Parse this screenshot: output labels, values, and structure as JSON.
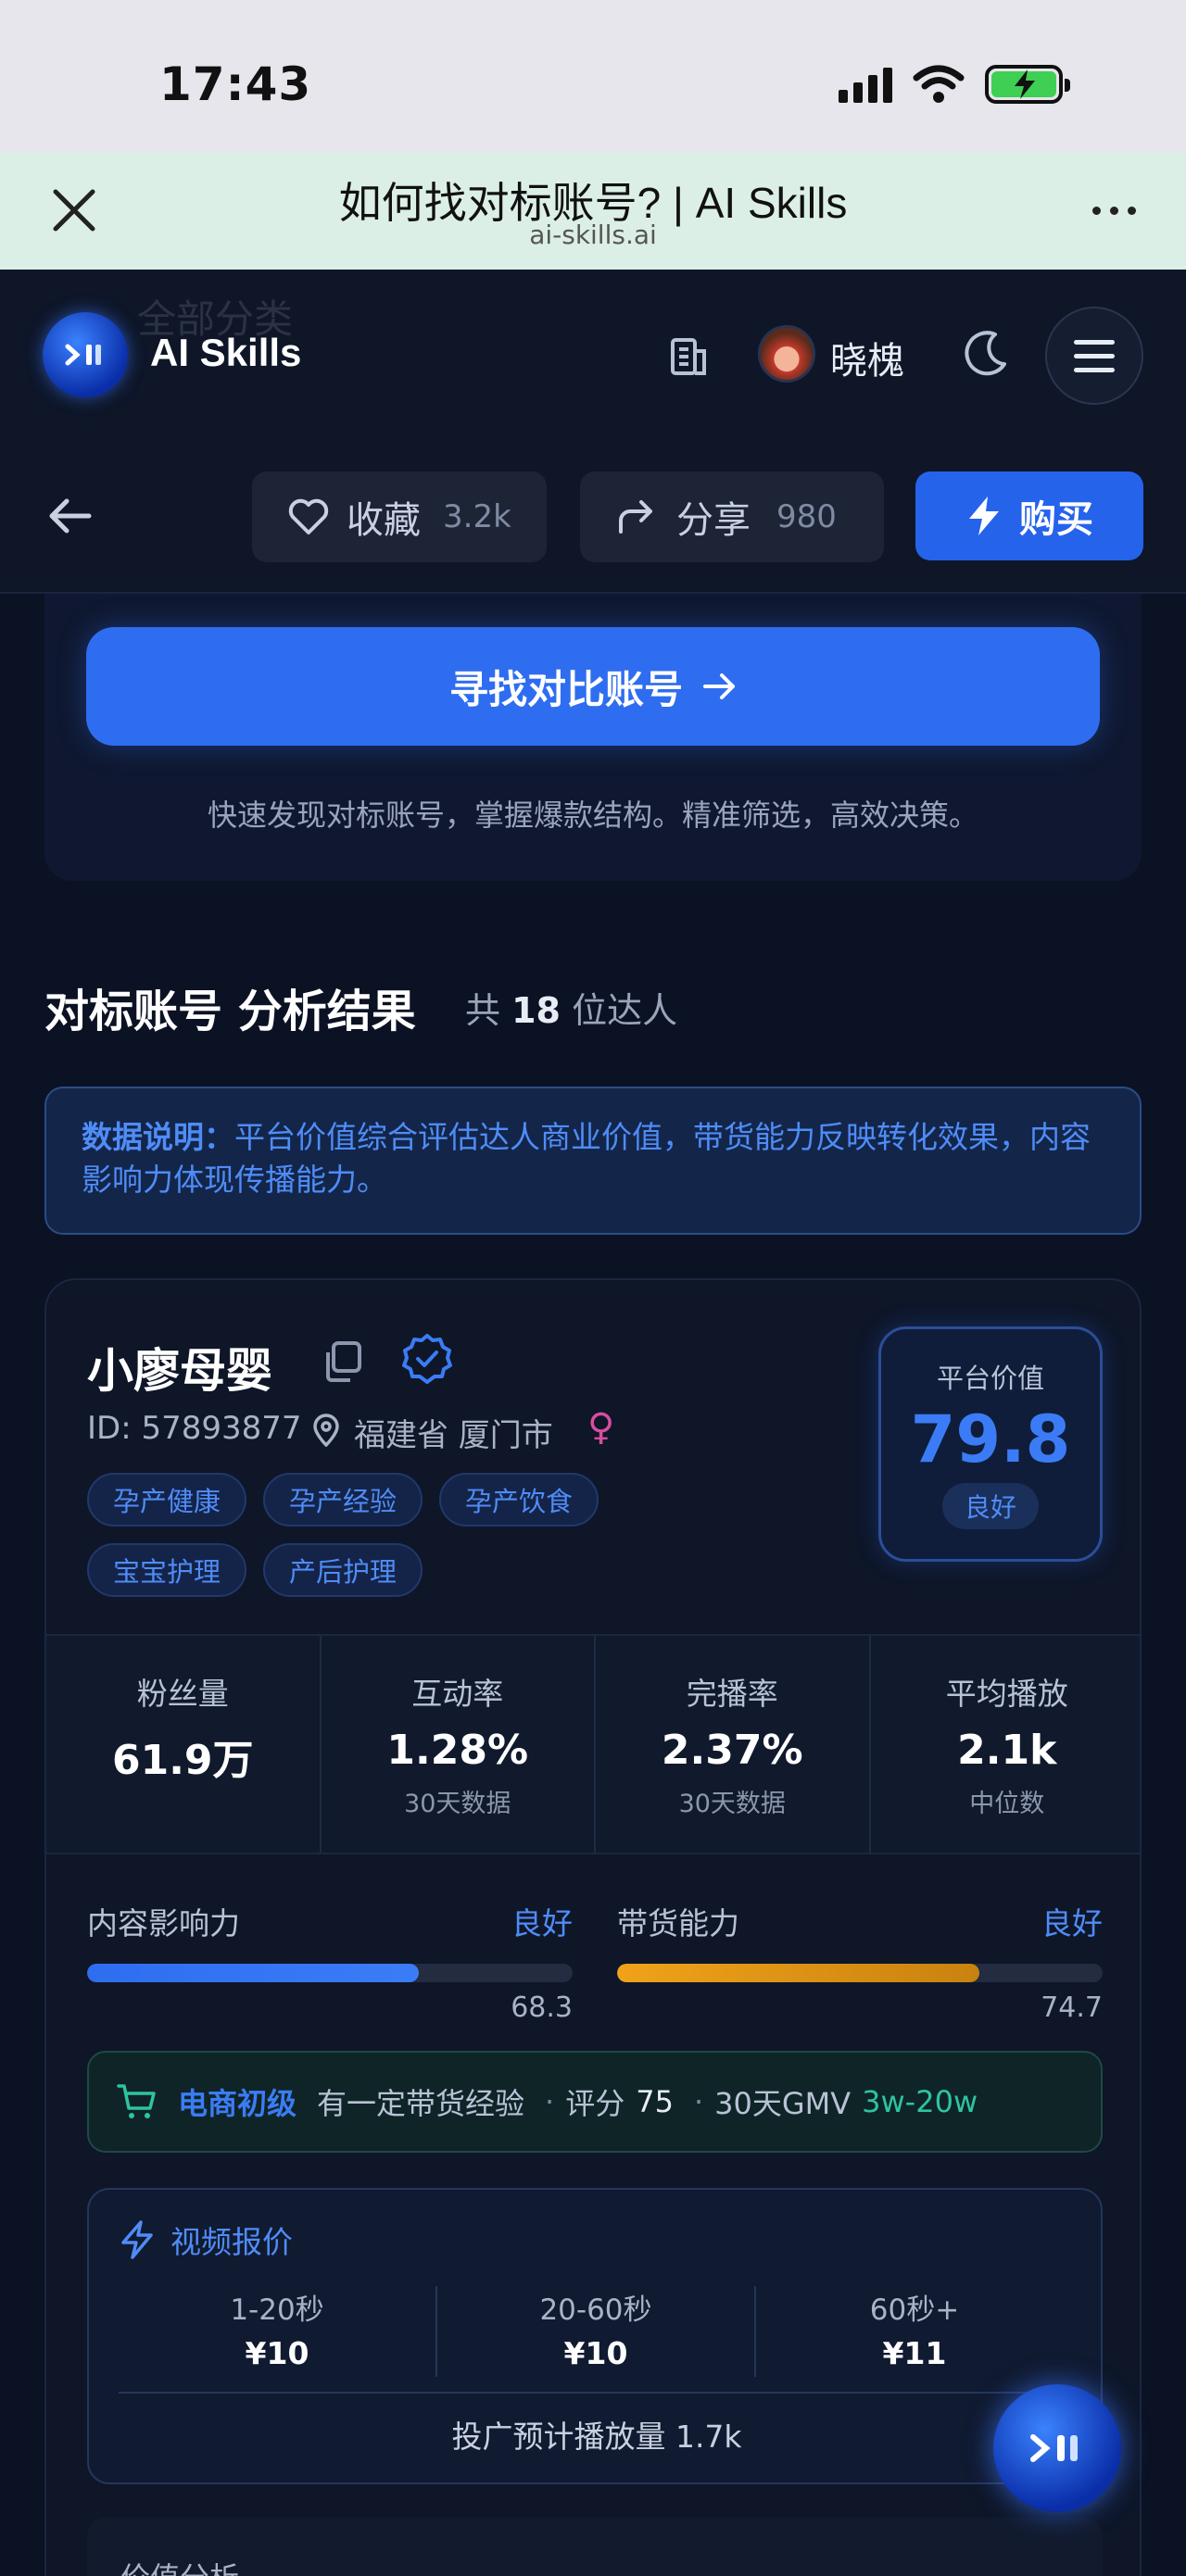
{
  "status": {
    "time": "17:43"
  },
  "browser": {
    "title": "如何找对标账号? | AI Skills",
    "url": "ai-skills.ai"
  },
  "nav": {
    "brand": "AI Skills",
    "ghost_text": "全部分类",
    "user_name": "晓槐"
  },
  "actions": {
    "favorite_label": "收藏",
    "favorite_count": "3.2k",
    "share_label": "分享",
    "share_count": "980",
    "buy_label": "购买"
  },
  "search": {
    "button_label": "寻找对比账号",
    "description": "快速发现对标账号，掌握爆款结构。精准筛选，高效决策。"
  },
  "results": {
    "title": "对标账号 分析结果",
    "count_prefix": "共",
    "count": "18",
    "count_suffix": "位达人"
  },
  "notice": {
    "label": "数据说明：",
    "text": "平台价值综合评估达人商业价值，带货能力反映转化效果，内容影响力体现传播能力。"
  },
  "creator": {
    "name": "小廖母婴",
    "id": "ID: 57893877",
    "location": "福建省 厦门市",
    "gender_icon": "♀",
    "tags": [
      "孕产健康",
      "孕产经验",
      "孕产饮食",
      "宝宝护理",
      "产后护理"
    ],
    "platform_value": {
      "label": "平台价值",
      "value": "79.8",
      "rating": "良好"
    },
    "stats": [
      {
        "label": "粉丝量",
        "value": "61.9万",
        "sub": ""
      },
      {
        "label": "互动率",
        "value": "1.28%",
        "sub": "30天数据"
      },
      {
        "label": "完播率",
        "value": "2.37%",
        "sub": "30天数据"
      },
      {
        "label": "平均播放",
        "value": "2.1k",
        "sub": "中位数"
      }
    ],
    "influence": {
      "label": "内容影响力",
      "rating": "良好",
      "value": "68.3",
      "percent": 68.3,
      "color": "#3b7cf6"
    },
    "sales": {
      "label": "带货能力",
      "rating": "良好",
      "value": "74.7",
      "percent": 74.7,
      "color": "#f0a21a"
    },
    "ecommerce": {
      "level": "电商初级",
      "desc": "有一定带货经验",
      "score_label": "评分",
      "score": "75",
      "gmv_label": "30天GMV",
      "gmv": "3w-20w"
    },
    "pricing": {
      "title": "视频报价",
      "cols": [
        {
          "label": "1-20秒",
          "value": "¥10"
        },
        {
          "label": "20-60秒",
          "value": "¥10"
        },
        {
          "label": "60秒+",
          "value": "¥11"
        }
      ],
      "footer": "投广预计播放量 1.7k"
    },
    "value_analysis_title": "价值分析"
  },
  "colors": {
    "accent": "#2563eb",
    "background": "#0b1224",
    "good": "#4f8cf7"
  }
}
